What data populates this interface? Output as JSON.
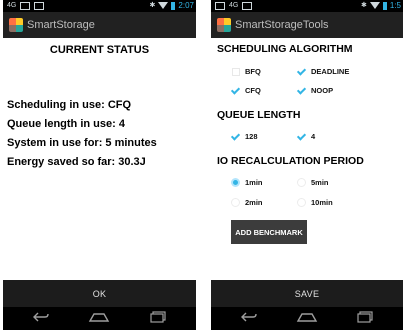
{
  "left": {
    "status": {
      "left_label": "4G",
      "right_time": "2:07"
    },
    "app_title": "SmartStorage",
    "heading": "CURRENT STATUS",
    "lines": [
      "Scheduling in use: CFQ",
      "Queue length in use: 4",
      "System in use for: 5 minutes",
      "Energy saved so far: 30.3J"
    ],
    "ok_label": "OK"
  },
  "right": {
    "status": {
      "left_label": "4G",
      "right_time": "1:5"
    },
    "app_title": "SmartStorageTools",
    "scheduling": {
      "title": "SCHEDULING ALGORITHM",
      "options": [
        {
          "label": "BFQ",
          "checked": false
        },
        {
          "label": "DEADLINE",
          "checked": true
        },
        {
          "label": "CFQ",
          "checked": true
        },
        {
          "label": "NOOP",
          "checked": true
        }
      ]
    },
    "queue": {
      "title": "QUEUE LENGTH",
      "options": [
        {
          "label": "128",
          "checked": true
        },
        {
          "label": "4",
          "checked": true
        }
      ]
    },
    "recalc": {
      "title": "IO RECALCULATION PERIOD",
      "options": [
        {
          "label": "1min",
          "selected": true
        },
        {
          "label": "5min",
          "selected": false
        },
        {
          "label": "2min",
          "selected": false
        },
        {
          "label": "10min",
          "selected": false
        }
      ]
    },
    "benchmark_label": "ADD BENCHMARK",
    "save_label": "SAVE"
  },
  "icons": {
    "back": "back-arrow-icon",
    "home": "home-icon",
    "recent": "recent-apps-icon"
  },
  "colors": {
    "accent": "#33b5e5",
    "actionbar": "#212121"
  }
}
